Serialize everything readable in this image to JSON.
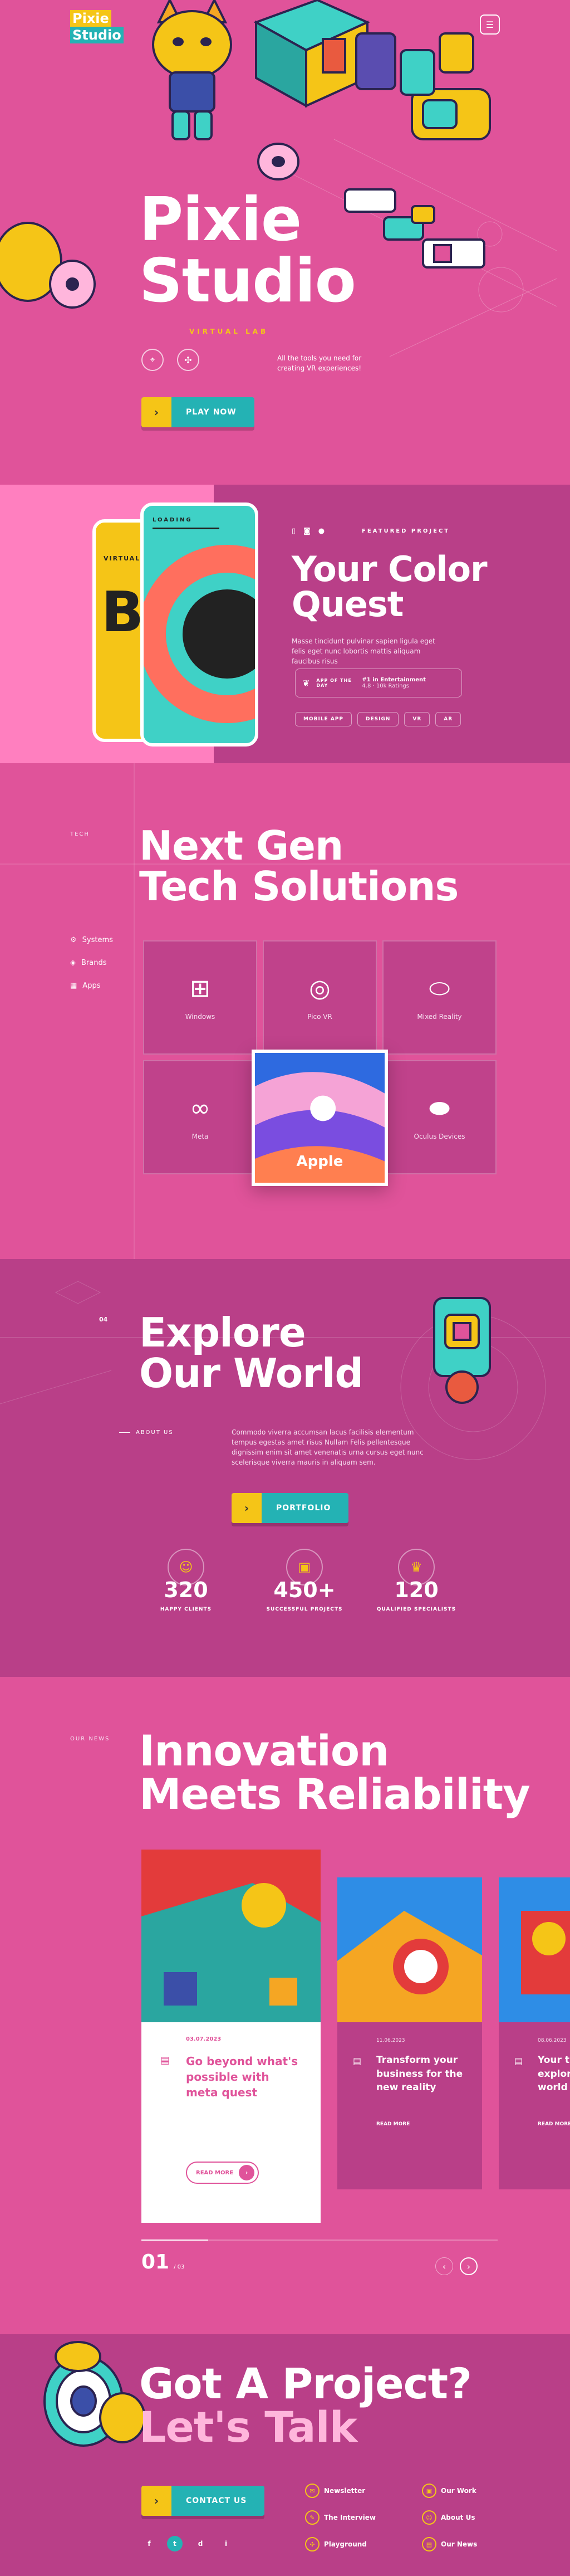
{
  "brand": {
    "logo_line1": "Pixie",
    "logo_line2": "Studio"
  },
  "hero": {
    "title_line1": "Pixie",
    "title_line2": "Studio",
    "subtitle": "VIRTUAL LAB",
    "tagline": "All the tools you need for creating VR experiences!",
    "cta_label": "PLAY NOW"
  },
  "quest": {
    "phone_loading": "LOADING",
    "phone_left_text": "VIRTUAL R",
    "phone_big_letters": "BOM",
    "featured": "FEATURED PROJECT",
    "title_line1": "Your Color",
    "title_line2": "Quest",
    "description": "Masse tincidunt pulvinar sapien ligula eget felis eget nunc lobortis mattis aliquam faucibus risus",
    "badge_rank": "#1 in Entertainment",
    "badge_award": "APP OF THE DAY",
    "badge_rating": "4.8 · 10k Ratings",
    "tags": [
      "MOBILE APP",
      "DESIGN",
      "VR",
      "AR"
    ]
  },
  "tech": {
    "eyebrow": "TECH",
    "title_line1": "Next Gen",
    "title_line2": "Tech Solutions",
    "side_menu": [
      {
        "label": "Systems",
        "icon": "gear-icon"
      },
      {
        "label": "Brands",
        "icon": "layers-icon"
      },
      {
        "label": "Apps",
        "icon": "grid-icon"
      }
    ],
    "tiles": [
      "Windows",
      "Pico VR",
      "Mixed Reality",
      "Meta",
      "Apple",
      "Oculus Devices"
    ]
  },
  "explore": {
    "number": "04",
    "title_line1": "Explore",
    "title_line2": "Our World",
    "about_label": "ABOUT US",
    "about_text": "Commodo viverra accumsan lacus facilisis elementum tempus egestas amet risus Nullam Felis pellentesque dignissim enim sit amet venenatis urna cursus eget nunc scelerisque viverra mauris in aliquam sem.",
    "cta_label": "PORTFOLIO",
    "stats": [
      {
        "value": "320",
        "label": "HAPPY CLIENTS",
        "icon": "user-icon"
      },
      {
        "value": "450+",
        "label": "SUCCESSFUL PROJECTS",
        "icon": "briefcase-icon"
      },
      {
        "value": "120",
        "label": "QUALIFIED SPECIALISTS",
        "icon": "crown-icon"
      }
    ]
  },
  "news": {
    "eyebrow": "OUR NEWS",
    "title_line1": "Innovation",
    "title_line2": "Meets Reliability",
    "cards": [
      {
        "date": "03.07.2023",
        "title": "Go beyond what's possible with meta quest",
        "more": "READ MORE"
      },
      {
        "date": "11.06.2023",
        "title": "Transform your business for the new reality",
        "more": "READ MORE"
      },
      {
        "date": "08.06.2023",
        "title": "Your t explor world",
        "more": "READ MORE"
      }
    ],
    "page_current": "01",
    "page_total": "/ 03"
  },
  "contact": {
    "title_line1": "Got A Project?",
    "title_line2": "Let's Talk",
    "cta_label": "CONTACT US",
    "links": [
      "Newsletter",
      "The Interview",
      "Playground",
      "Our Work",
      "About Us",
      "Our News"
    ],
    "social": [
      "f",
      "t",
      "d",
      "i"
    ]
  },
  "colors": {
    "pink": "#e0539a",
    "deep_pink": "#b93f88",
    "yellow": "#f5c517",
    "teal": "#24b2b4",
    "light_pink": "#ffb6dc"
  }
}
